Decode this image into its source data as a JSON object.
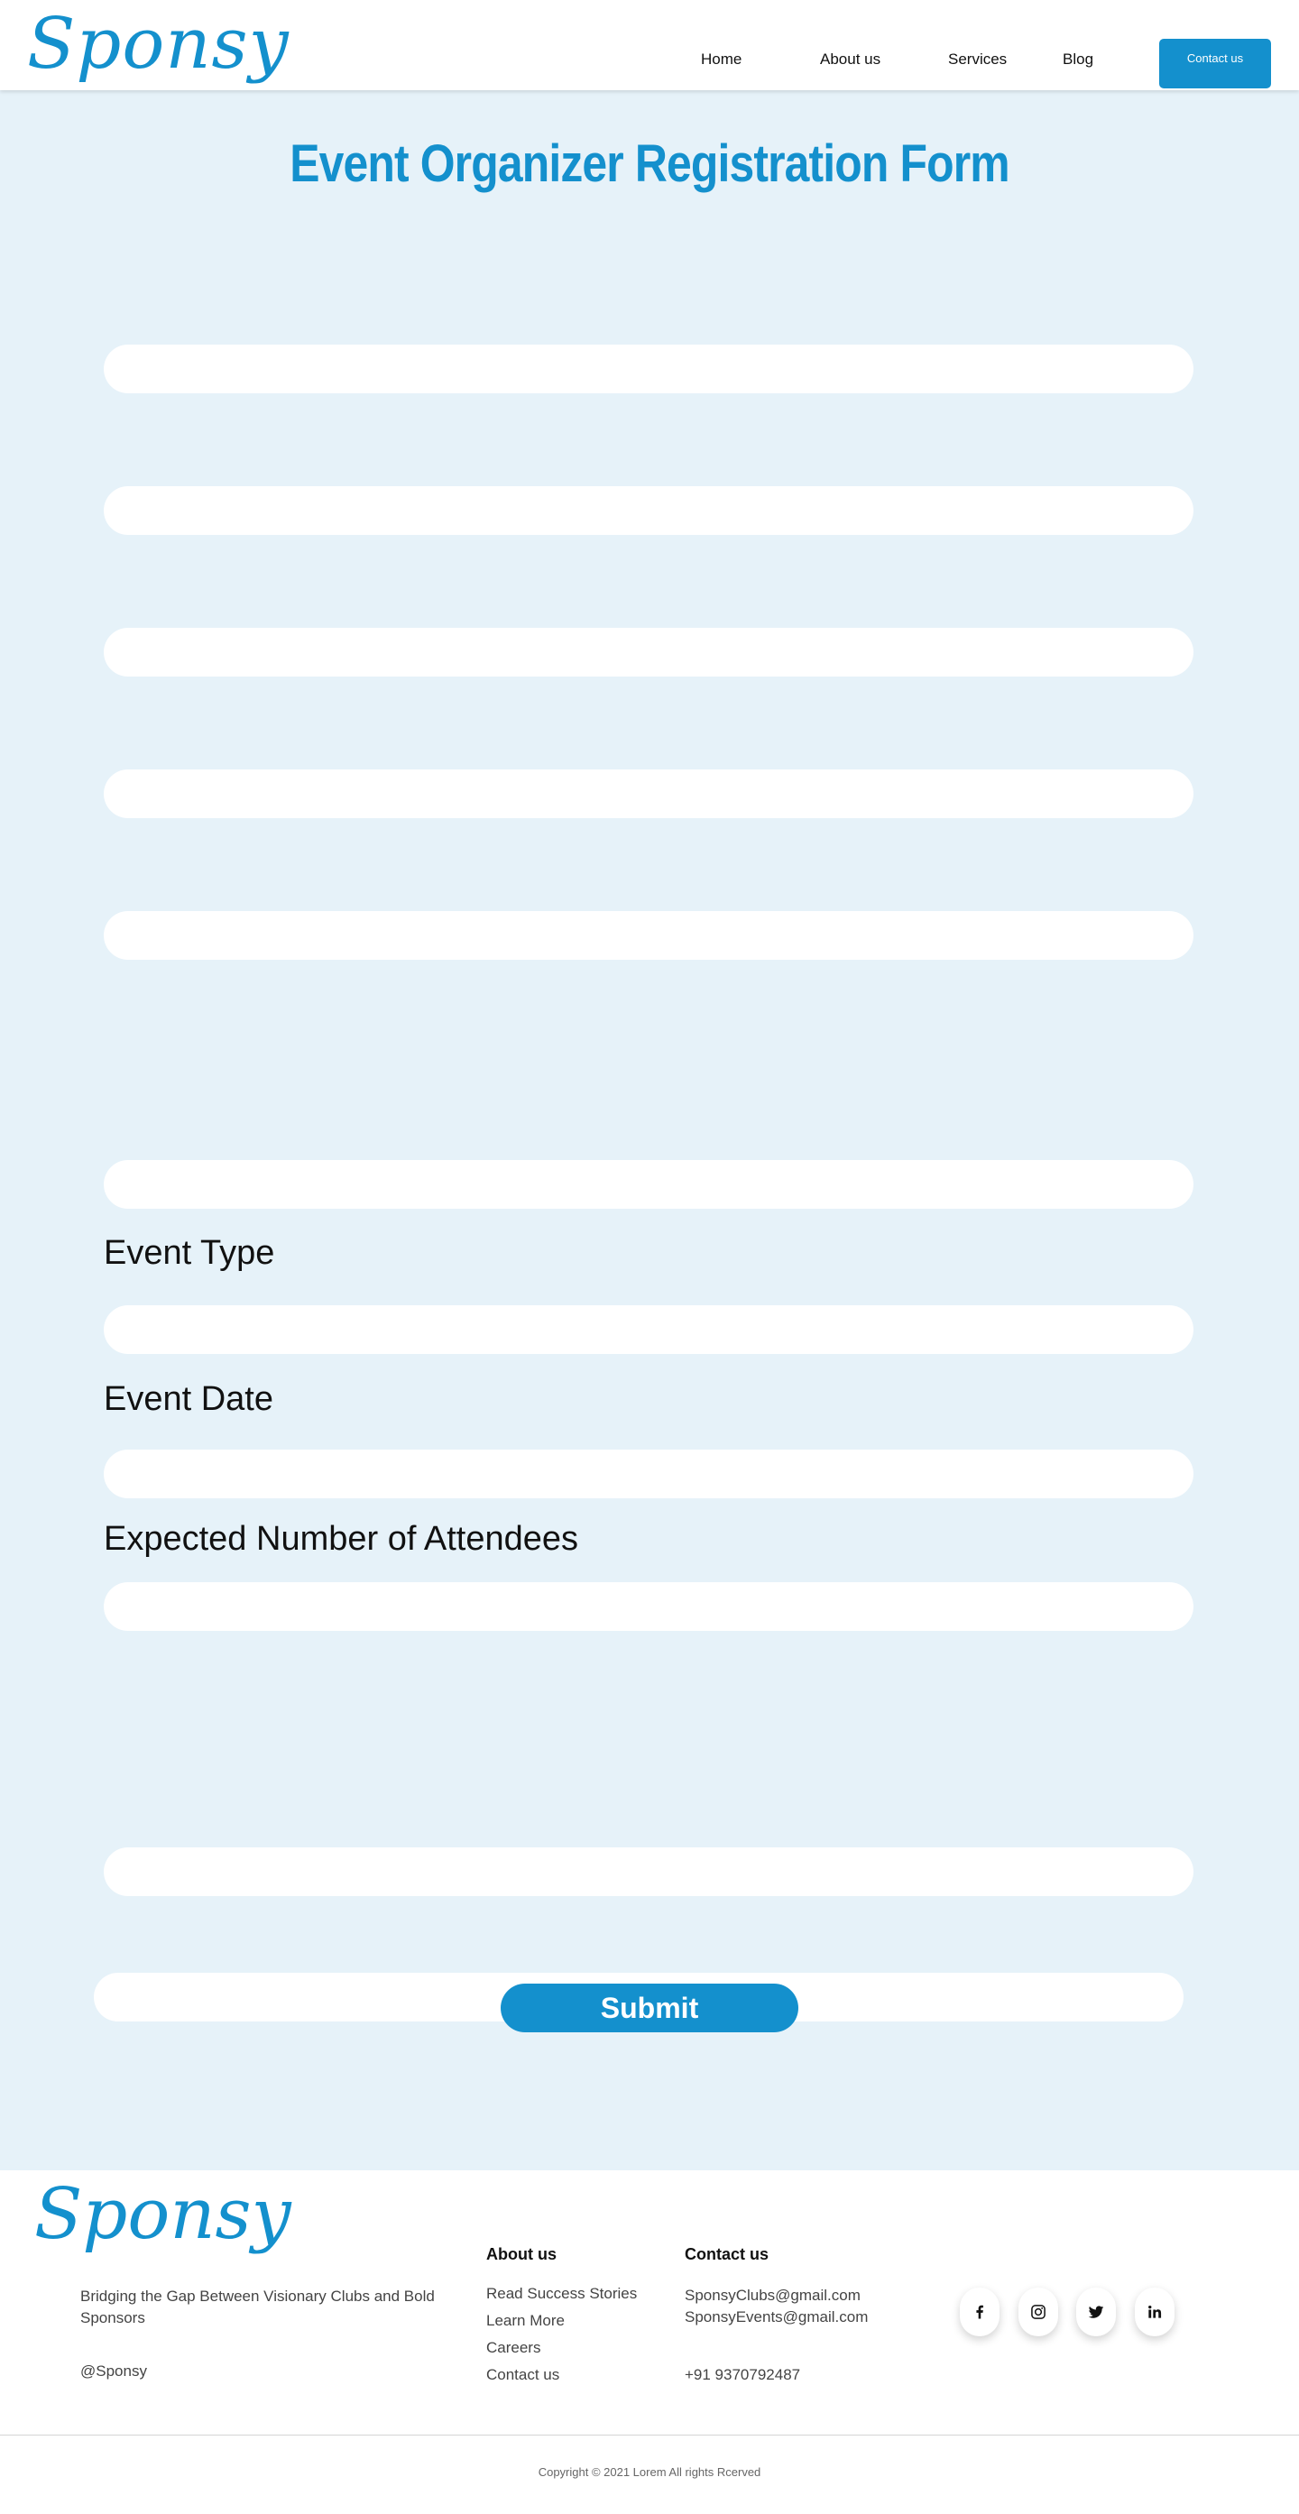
{
  "brand": {
    "logo": "Sponsy",
    "accent": "#1490cd"
  },
  "nav": {
    "items": [
      {
        "label": "Home"
      },
      {
        "label": "About us"
      },
      {
        "label": "Services"
      },
      {
        "label": "Blog"
      }
    ],
    "contact_label": "Contact us"
  },
  "form": {
    "title": "Event Organizer Registration Form",
    "labels": {
      "event_type": "Event Type",
      "event_date": "Event Date",
      "attendees": "Expected Number of Attendees"
    },
    "submit_label": "Submit"
  },
  "footer": {
    "logo": "Sponsy",
    "tagline": "Bridging the Gap Between Visionary Clubs and Bold Sponsors",
    "handle": "@Sponsy",
    "about": {
      "heading": "About us",
      "links": [
        "Read Success Stories",
        "Learn More",
        "Careers",
        "Contact us"
      ]
    },
    "contact": {
      "heading": "Contact us",
      "email1": "SponsyClubs@gmail.com",
      "email2": "SponsyEvents@gmail.com",
      "phone": "+91 9370792487"
    },
    "social": [
      "facebook-icon",
      "instagram-icon",
      "twitter-icon",
      "linkedin-icon"
    ],
    "copyright": "Copyright © 2021 Lorem All rights Rcerved"
  }
}
